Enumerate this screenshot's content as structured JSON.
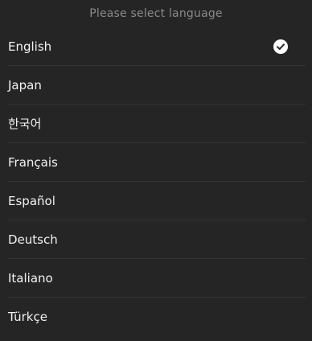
{
  "header": {
    "title": "Please select language"
  },
  "languages": [
    {
      "label": "English",
      "selected": true
    },
    {
      "label": "Japan",
      "selected": false
    },
    {
      "label": "한국어",
      "selected": false
    },
    {
      "label": "Français",
      "selected": false
    },
    {
      "label": "Español",
      "selected": false
    },
    {
      "label": "Deutsch",
      "selected": false
    },
    {
      "label": "Italiano",
      "selected": false
    },
    {
      "label": "Türkçe",
      "selected": false
    }
  ],
  "icons": {
    "selected": "check-circle-icon"
  },
  "colors": {
    "background": "#252525",
    "text": "#f2f2f2",
    "muted": "#8a8a8a",
    "divider": "#333333",
    "check": "#ffffff"
  }
}
